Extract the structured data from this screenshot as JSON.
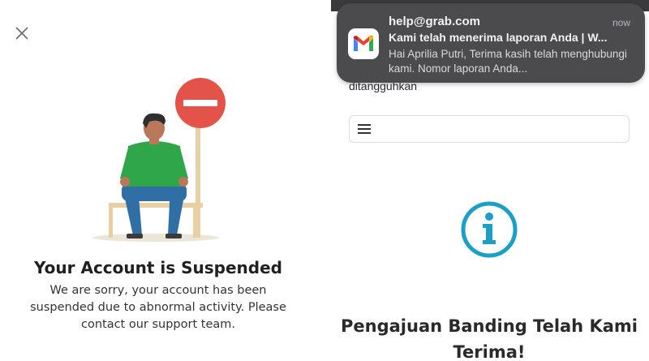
{
  "left": {
    "title": "Your Account is Suspended",
    "description": "We are sorry, your account has been suspended due to abnormal activity. Please contact our support team.",
    "icons": {
      "close": "close-icon",
      "illustration": "suspended-person-illustration",
      "no_entry": "no-entry-sign-icon"
    }
  },
  "right": {
    "partial_text": "ditangguhkan",
    "title": "Pengajuan Banding Telah Kami Terima!",
    "icons": {
      "menu": "hamburger-menu-icon",
      "info": "info-icon"
    }
  },
  "notification": {
    "sender": "help@grab.com",
    "time": "now",
    "subject": "Kami telah menerima laporan Anda | W...",
    "body": "Hai Aprilia Putri, Terima kasih telah menghubungi kami. Nomor laporan Anda...",
    "app_icon": "gmail-icon"
  },
  "colors": {
    "no_entry_red": "#e3534a",
    "shirt_green": "#2fa64a",
    "pants_blue": "#2f6fa6",
    "info_teal": "#1b9fc6",
    "notification_bg": "#4b4b4e"
  }
}
